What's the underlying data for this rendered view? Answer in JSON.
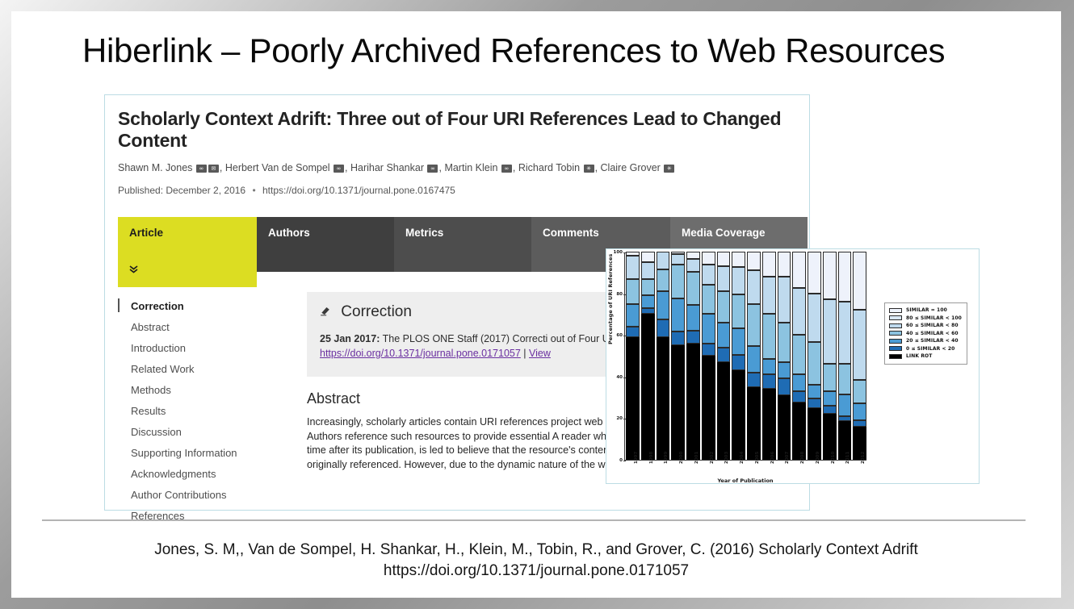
{
  "slide": {
    "title": "Hiberlink – Poorly Archived References to Web Resources"
  },
  "paper": {
    "title": "Scholarly Context Adrift: Three out of Four URI References Lead to Changed Content",
    "authors": [
      {
        "name": "Shawn M. Jones",
        "icons": [
          "orcid-icon",
          "email-icon"
        ]
      },
      {
        "name": "Herbert Van de Sompel",
        "icons": [
          "orcid-icon"
        ]
      },
      {
        "name": "Harihar Shankar",
        "icons": [
          "orcid-icon"
        ]
      },
      {
        "name": "Martin Klein",
        "icons": [
          "orcid-icon"
        ]
      },
      {
        "name": "Richard Tobin",
        "icons": [
          "affiliation-icon"
        ]
      },
      {
        "name": "Claire Grover",
        "icons": [
          "affiliation-icon"
        ]
      }
    ],
    "published_label": "Published: December 2, 2016",
    "doi": "https://doi.org/10.1371/journal.pone.0167475"
  },
  "tabs": [
    {
      "label": "Article",
      "active": true,
      "chevron": "»"
    },
    {
      "label": "Authors",
      "active": false
    },
    {
      "label": "Metrics",
      "active": false
    },
    {
      "label": "Comments",
      "active": false
    },
    {
      "label": "Media Coverage",
      "active": false
    }
  ],
  "toc": {
    "items": [
      {
        "label": "Correction",
        "current": true
      },
      {
        "label": "Abstract",
        "current": false
      },
      {
        "label": "Introduction",
        "current": false
      },
      {
        "label": "Related Work",
        "current": false
      },
      {
        "label": "Methods",
        "current": false
      },
      {
        "label": "Results",
        "current": false
      },
      {
        "label": "Discussion",
        "current": false
      },
      {
        "label": "Supporting Information",
        "current": false
      },
      {
        "label": "Acknowledgments",
        "current": false
      },
      {
        "label": "Author Contributions",
        "current": false
      },
      {
        "label": "References",
        "current": false
      }
    ]
  },
  "correction": {
    "heading": "Correction",
    "icon": "eraser-icon",
    "date": "25 Jan 2017:",
    "body": " The PLOS ONE Staff (2017) Correcti out of Four URI References Lead to Changed Cont",
    "link": "https://doi.org/10.1371/journal.pone.0171057",
    "link_sep": " | ",
    "link2": "View"
  },
  "abstract": {
    "heading": "Abstract",
    "body": "Increasingly, scholarly articles contain URI references project web sites, scholarly wikis, ontologies, online de Authors reference such resources to provide essential A reader who visits a web at large resource by followin time after its publication, is led to believe that the resource's content is representative of what the author originally referenced. However, due to the dynamic nature of the web, that may very"
  },
  "footer": {
    "line1": "Jones, S. M,, Van de Sompel, H. Shankar, H., Klein, M., Tobin, R., and Grover, C. (2016) Scholarly Context Adrift",
    "line2": "https://doi.org/10.1371/journal.pone.0171057"
  },
  "chart_data": {
    "type": "bar",
    "stacked": true,
    "title": "",
    "xlabel": "Year of Publication",
    "ylabel": "Percentage of URI References",
    "ylim": [
      0,
      100
    ],
    "yticks": [
      0,
      20,
      40,
      60,
      80,
      100
    ],
    "grid": false,
    "legend_position": "right",
    "categories": [
      "1997",
      "1998",
      "1999",
      "2000",
      "2001",
      "2002",
      "2003",
      "2004",
      "2005",
      "2006",
      "2007",
      "2008",
      "2009",
      "2010",
      "2011",
      "2012"
    ],
    "series": [
      {
        "name": "LINK ROT",
        "color": "#000000",
        "values": [
          59,
          70,
          59,
          55,
          56,
          50,
          47,
          43,
          35,
          34,
          31,
          27.5,
          25,
          22,
          18.5,
          16
        ]
      },
      {
        "name": "0 ≤ SIMILAR < 20",
        "color": "#1f6cb4",
        "values": [
          5,
          3,
          8.5,
          6.5,
          6,
          6,
          7,
          7.5,
          7,
          7,
          8,
          5.5,
          4.5,
          4,
          2.5,
          3
        ]
      },
      {
        "name": "20 ≤ SIMILAR < 40",
        "color": "#4a9bd4",
        "values": [
          11,
          6,
          13.5,
          16,
          12.5,
          14,
          12,
          12.5,
          12.5,
          7.5,
          8,
          8,
          6.5,
          7,
          10.5,
          8
        ]
      },
      {
        "name": "40 ≤ SIMILAR < 60",
        "color": "#8cc3e0",
        "values": [
          12,
          8,
          10.5,
          16.5,
          16,
          14,
          15,
          16.5,
          20.5,
          21.5,
          19,
          19,
          20.5,
          13,
          14.5,
          11.5
        ]
      },
      {
        "name": "60 ≤ SIMILAR < 80",
        "color": "#bfdaee",
        "values": [
          11,
          8,
          8.5,
          5,
          6,
          10,
          12,
          13,
          16,
          18,
          22,
          22.5,
          23.5,
          31,
          30,
          33.5
        ]
      },
      {
        "name": "80 ≤ SIMILAR < 100",
        "color": "#d9e7f5",
        "values": [
          0,
          0,
          0,
          0,
          0,
          0,
          0,
          0,
          0,
          0,
          0,
          0,
          0,
          0,
          0,
          0
        ]
      },
      {
        "name": "SIMILAR = 100",
        "color": "#eef2fb",
        "values": [
          2,
          5,
          0,
          1,
          3.5,
          6,
          7,
          7.5,
          9,
          12,
          12,
          17.5,
          20,
          23,
          24,
          28
        ]
      }
    ],
    "legend": [
      {
        "label": "SIMILAR = 100",
        "color": "#eef2fb"
      },
      {
        "label": "80 ≤ SIMILAR < 100",
        "color": "#d9e7f5"
      },
      {
        "label": "60 ≤ SIMILAR < 80",
        "color": "#bfdaee"
      },
      {
        "label": "40 ≤ SIMILAR < 60",
        "color": "#8cc3e0"
      },
      {
        "label": "20 ≤ SIMILAR < 40",
        "color": "#4a9bd4"
      },
      {
        "label": "0 ≤ SIMILAR < 20",
        "color": "#1f6cb4"
      },
      {
        "label": "LINK ROT",
        "color": "#000000"
      }
    ]
  }
}
